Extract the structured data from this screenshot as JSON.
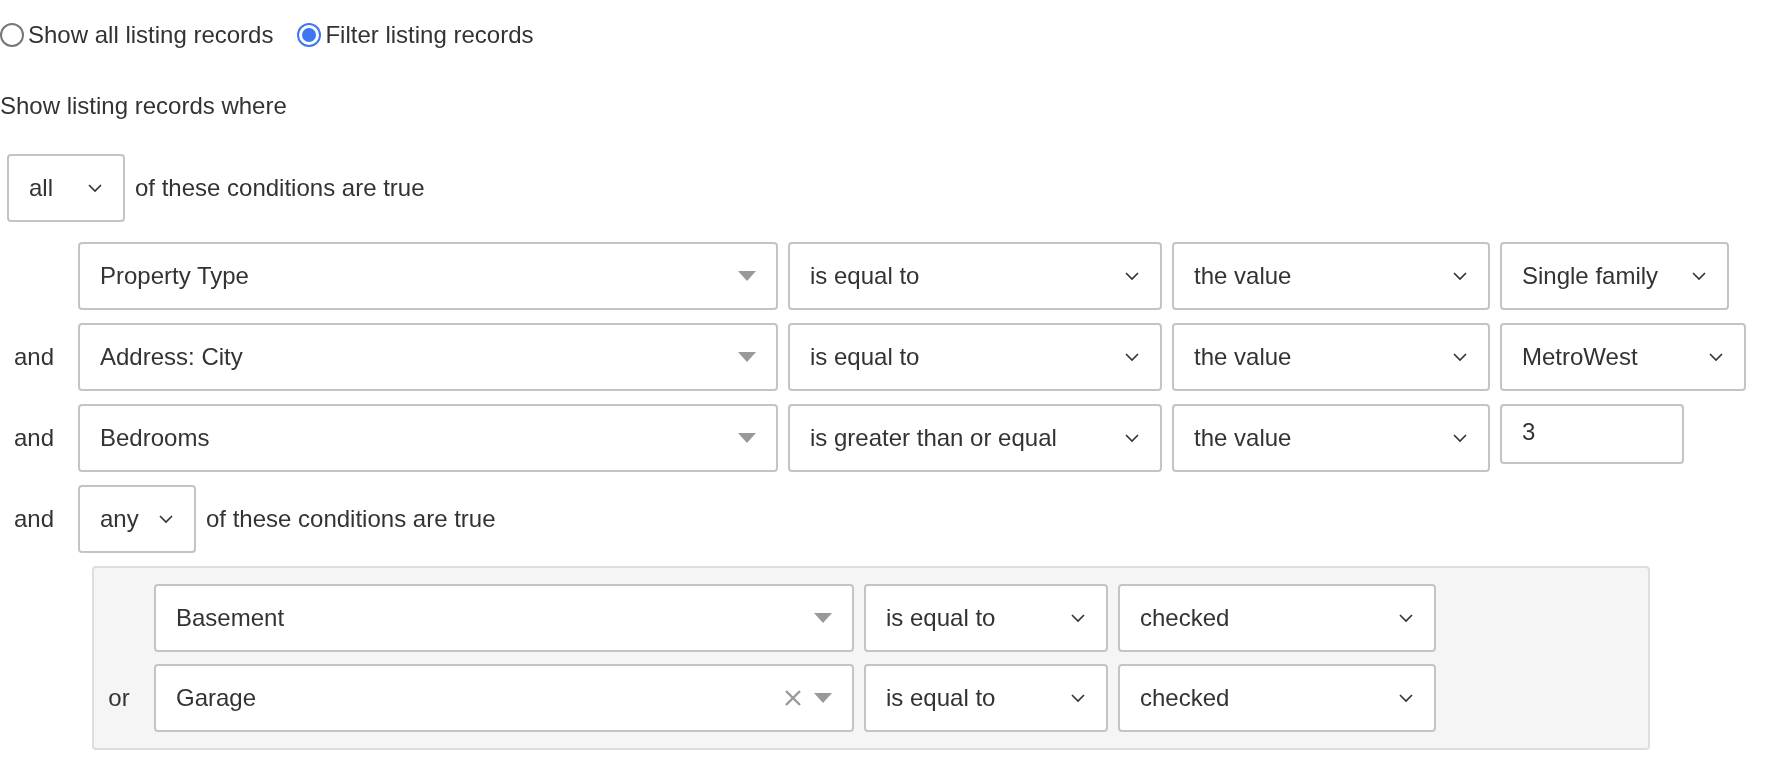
{
  "mode_options": [
    {
      "label": "Show all listing records",
      "selected": false
    },
    {
      "label": "Filter listing records",
      "selected": true
    }
  ],
  "heading": "Show listing records where",
  "match": {
    "value": "all",
    "text": "of these conditions are true"
  },
  "conditions": [
    {
      "kind": "rule",
      "field": "Property Type",
      "clearable": false,
      "operator": "is equal to",
      "source": "the value",
      "value": {
        "kind": "select",
        "text": "Single family"
      }
    },
    {
      "kind": "rule",
      "conjunction": "and",
      "field": "Address: City",
      "clearable": false,
      "operator": "is equal to",
      "source": "the value",
      "value": {
        "kind": "select",
        "text": "MetroWest"
      }
    },
    {
      "kind": "rule",
      "conjunction": "and",
      "field": "Bedrooms",
      "clearable": false,
      "operator": "is greater than or equal",
      "source": "the value",
      "value": {
        "kind": "input",
        "text": "3"
      }
    },
    {
      "kind": "group",
      "conjunction": "and",
      "match": "any",
      "text": "of these conditions are true",
      "children": [
        {
          "field": "Basement",
          "clearable": false,
          "operator": "is equal to",
          "source": "checked"
        },
        {
          "conjunction": "or",
          "field": "Garage",
          "clearable": true,
          "operator": "is equal to",
          "source": "checked"
        }
      ]
    }
  ]
}
